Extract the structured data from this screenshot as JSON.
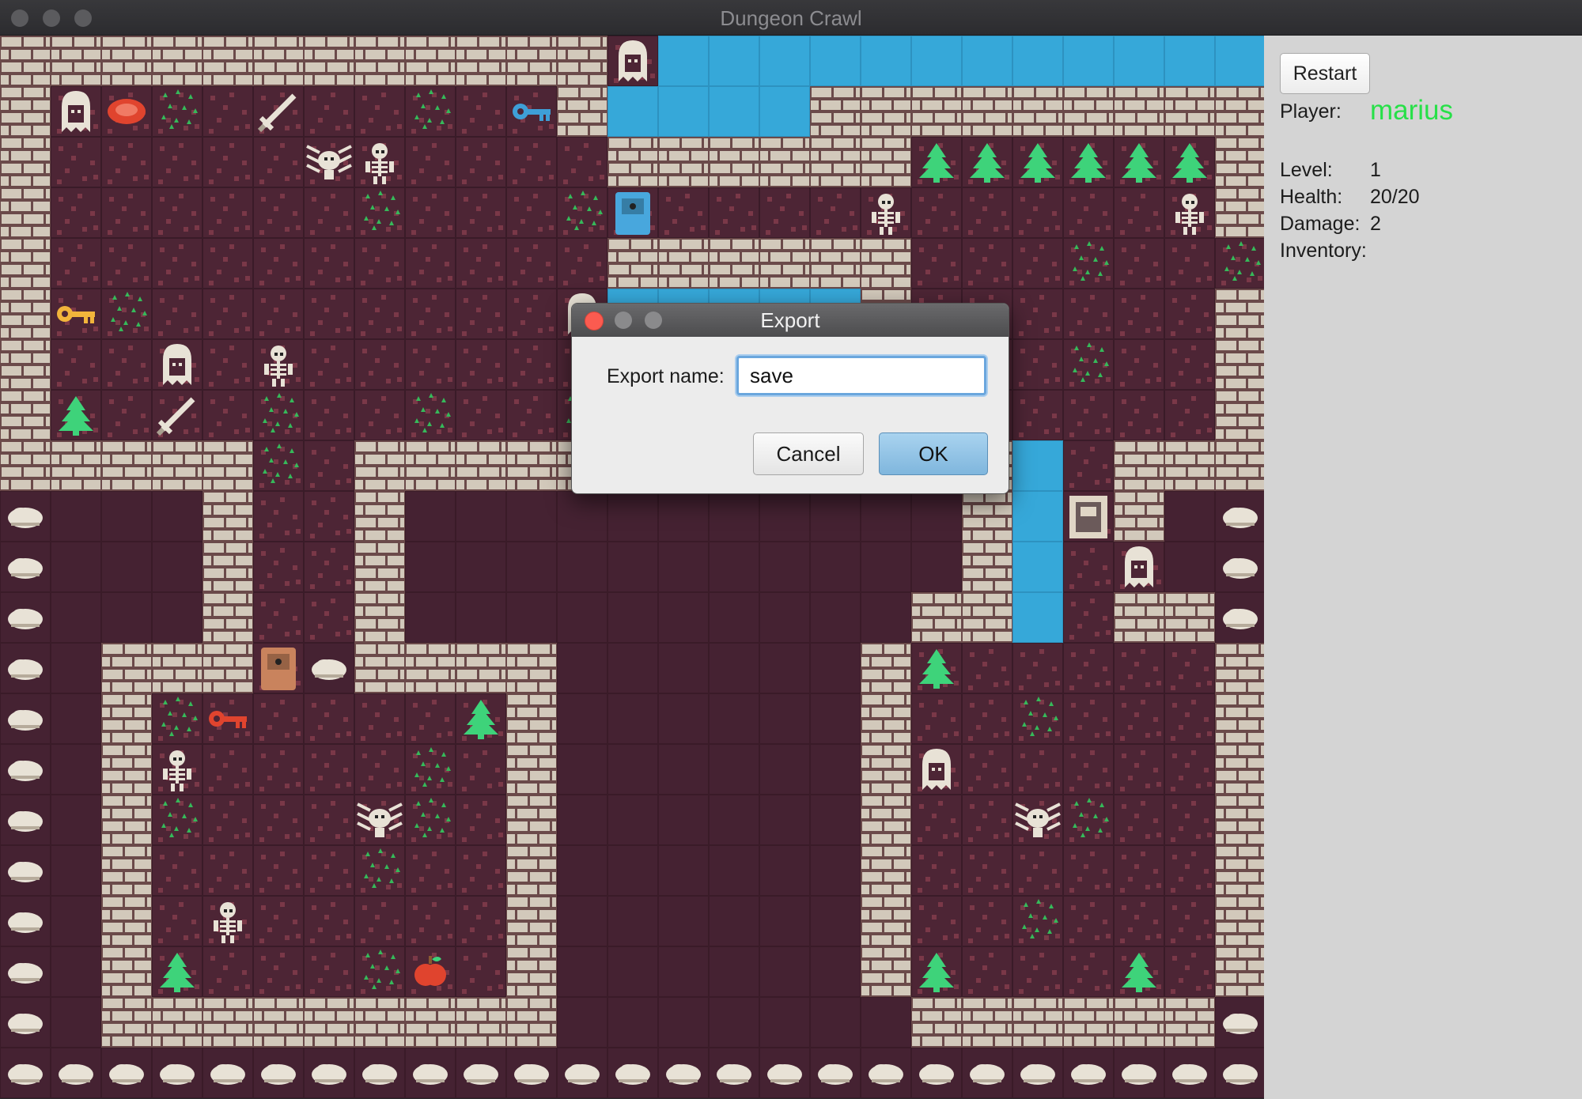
{
  "window": {
    "title": "Dungeon Crawl"
  },
  "side_panel": {
    "restart_label": "Restart",
    "player_label": "Player:",
    "player_name": "marius",
    "player_name_color": "#27e048",
    "stats": [
      {
        "label": "Level:",
        "value": "1"
      },
      {
        "label": "Health:",
        "value": "20/20"
      },
      {
        "label": "Damage:",
        "value": "2"
      },
      {
        "label": "Inventory:",
        "value": ""
      }
    ]
  },
  "dialog": {
    "title": "Export",
    "field_label": "Export name:",
    "field_value": "save",
    "cancel_label": "Cancel",
    "ok_label": "OK"
  },
  "map": {
    "legend": {
      "W": "brick-wall",
      "F": "floor",
      "E": "empty-floor",
      "R": "rock",
      "A": "water",
      "T": "tree",
      "G": "grass",
      "S": "skeleton",
      "H": "ghost",
      "B": "spider",
      "K": "key",
      "X": "sword",
      "D": "door",
      "M": "meat",
      "P": "apple",
      "L": "skeleton-warrior"
    },
    "colors": {
      "floor": "#4d2535",
      "floor_speck": "#7a3848",
      "empty": "#452232",
      "brick": "#d2c9bb",
      "mortar": "#6b4a4a",
      "water": "#36a8d9",
      "tree": "#3ed37a",
      "grass": "#36b95a",
      "bone": "#e8e2d6",
      "gold_key": "#f2b43b",
      "blue_key": "#3e9fd7",
      "red_key": "#e0442e",
      "wood_door": "#c9835d",
      "blue_door": "#48a7dd"
    },
    "rows": [
      "WWWWWWWWWWWWHAAAAAAAAAAAA",
      "WHMGFXFFGFKWAAAAWWWWWWWWW",
      "WFFFFFBSFFFFWWWWWWTTTTTTW",
      "WFFFFFFGFFFGDFFFFSFFFFFSW",
      "WFFFFFFFFFFFWWWWWWFFFGFFG",
      "WKGFFFFFFFFHAAAAAWFFFFFFW",
      "WFFHFSFFFFFFFFFFFFFFFGFFW",
      "WTFXFGFFGFFGFFFFFFFFFFFFW",
      "WWWWWGFWWWWWWWWWWWWWAFWWW",
      "REEEWFFWEEEEEEEEEEEWADWER",
      "REEEWFFWEEEEEEEEEEEWAFHER",
      "REEEWFFWEEEEEEEEEEWWAFWWR",
      "REWWWDRWWWWEEEEEEWTFFFFFW",
      "REWGKFFFFTWEEEEEEWFFGFFFW",
      "REWSFFFFGFWEEEEEEWHFFFFFW",
      "REWGFFFBGFWEEEEEEWFFBGFFW",
      "REWFFFFGFFWEEEEEEWFFFFFFW",
      "REWFLFFFFFWEEEEEEWFFGFFFW",
      "REWTFFFGPFWEEEEEEWTFFFTFW",
      "REWWWWWWWWWEEEEEEEWWWWWWR",
      "RRRRRRRRRRRRRRRRRRRRRRRRR"
    ],
    "item_colors": {
      "row1_key": "#3e9fd7",
      "row5_key": "#f2b43b",
      "row13_key": "#e0442e"
    }
  }
}
